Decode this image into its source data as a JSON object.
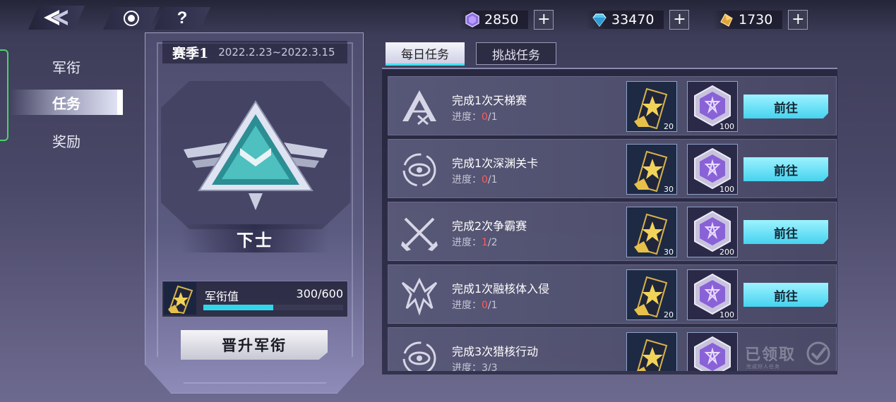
{
  "header": {
    "currencies": [
      {
        "icon": "purple-gem-icon",
        "value": "2850"
      },
      {
        "icon": "blue-diamond-icon",
        "value": "33470"
      },
      {
        "icon": "gold-crystal-icon",
        "value": "1730"
      }
    ],
    "help_label": "?"
  },
  "sidebar": {
    "items": [
      {
        "label": "军衔"
      },
      {
        "label": "任务"
      },
      {
        "label": "奖励"
      }
    ],
    "active_index": 1
  },
  "rank": {
    "season_title": "赛季1",
    "season_dates": "2022.2.23~2022.3.15",
    "name": "下士",
    "exp_label": "军衔值",
    "exp_value": "300/600",
    "exp_fraction": 0.5,
    "promote_label": "晋升军衔"
  },
  "tabs": [
    {
      "label": "每日任务",
      "active": true
    },
    {
      "label": "挑战任务",
      "active": false
    }
  ],
  "tasks": [
    {
      "icon": "ladder-match-icon",
      "title": "完成1次天梯赛",
      "progress_label": "进度：",
      "progress_current": "0",
      "progress_total": "/1",
      "reward1_count": "20",
      "reward2_count": "100",
      "button": "前往",
      "claimed": false
    },
    {
      "icon": "abyss-stage-icon",
      "title": "完成1次深渊关卡",
      "progress_label": "进度：",
      "progress_current": "0",
      "progress_total": "/1",
      "reward1_count": "30",
      "reward2_count": "100",
      "button": "前往",
      "claimed": false
    },
    {
      "icon": "crossed-swords-icon",
      "title": "完成2次争霸赛",
      "progress_label": "进度：",
      "progress_current": "1",
      "progress_total": "/2",
      "reward1_count": "30",
      "reward2_count": "200",
      "button": "前往",
      "claimed": false
    },
    {
      "icon": "fusion-invasion-icon",
      "title": "完成1次融核体入侵",
      "progress_label": "进度：",
      "progress_current": "0",
      "progress_total": "/1",
      "reward1_count": "20",
      "reward2_count": "100",
      "button": "前往",
      "claimed": false
    },
    {
      "icon": "hunt-operation-icon",
      "title": "完成3次猎核行动",
      "progress_label": "进度：",
      "progress_current": "3",
      "progress_total": "/3",
      "reward1_count": "",
      "reward2_count": "",
      "button": "",
      "claimed": true,
      "claimed_label": "已领取",
      "claimed_sub": "完成狩人任务"
    }
  ],
  "colors": {
    "accent_cyan": "#46d3ef",
    "progress_red": "#ff5b5b",
    "nav_green": "#4bd36b"
  }
}
